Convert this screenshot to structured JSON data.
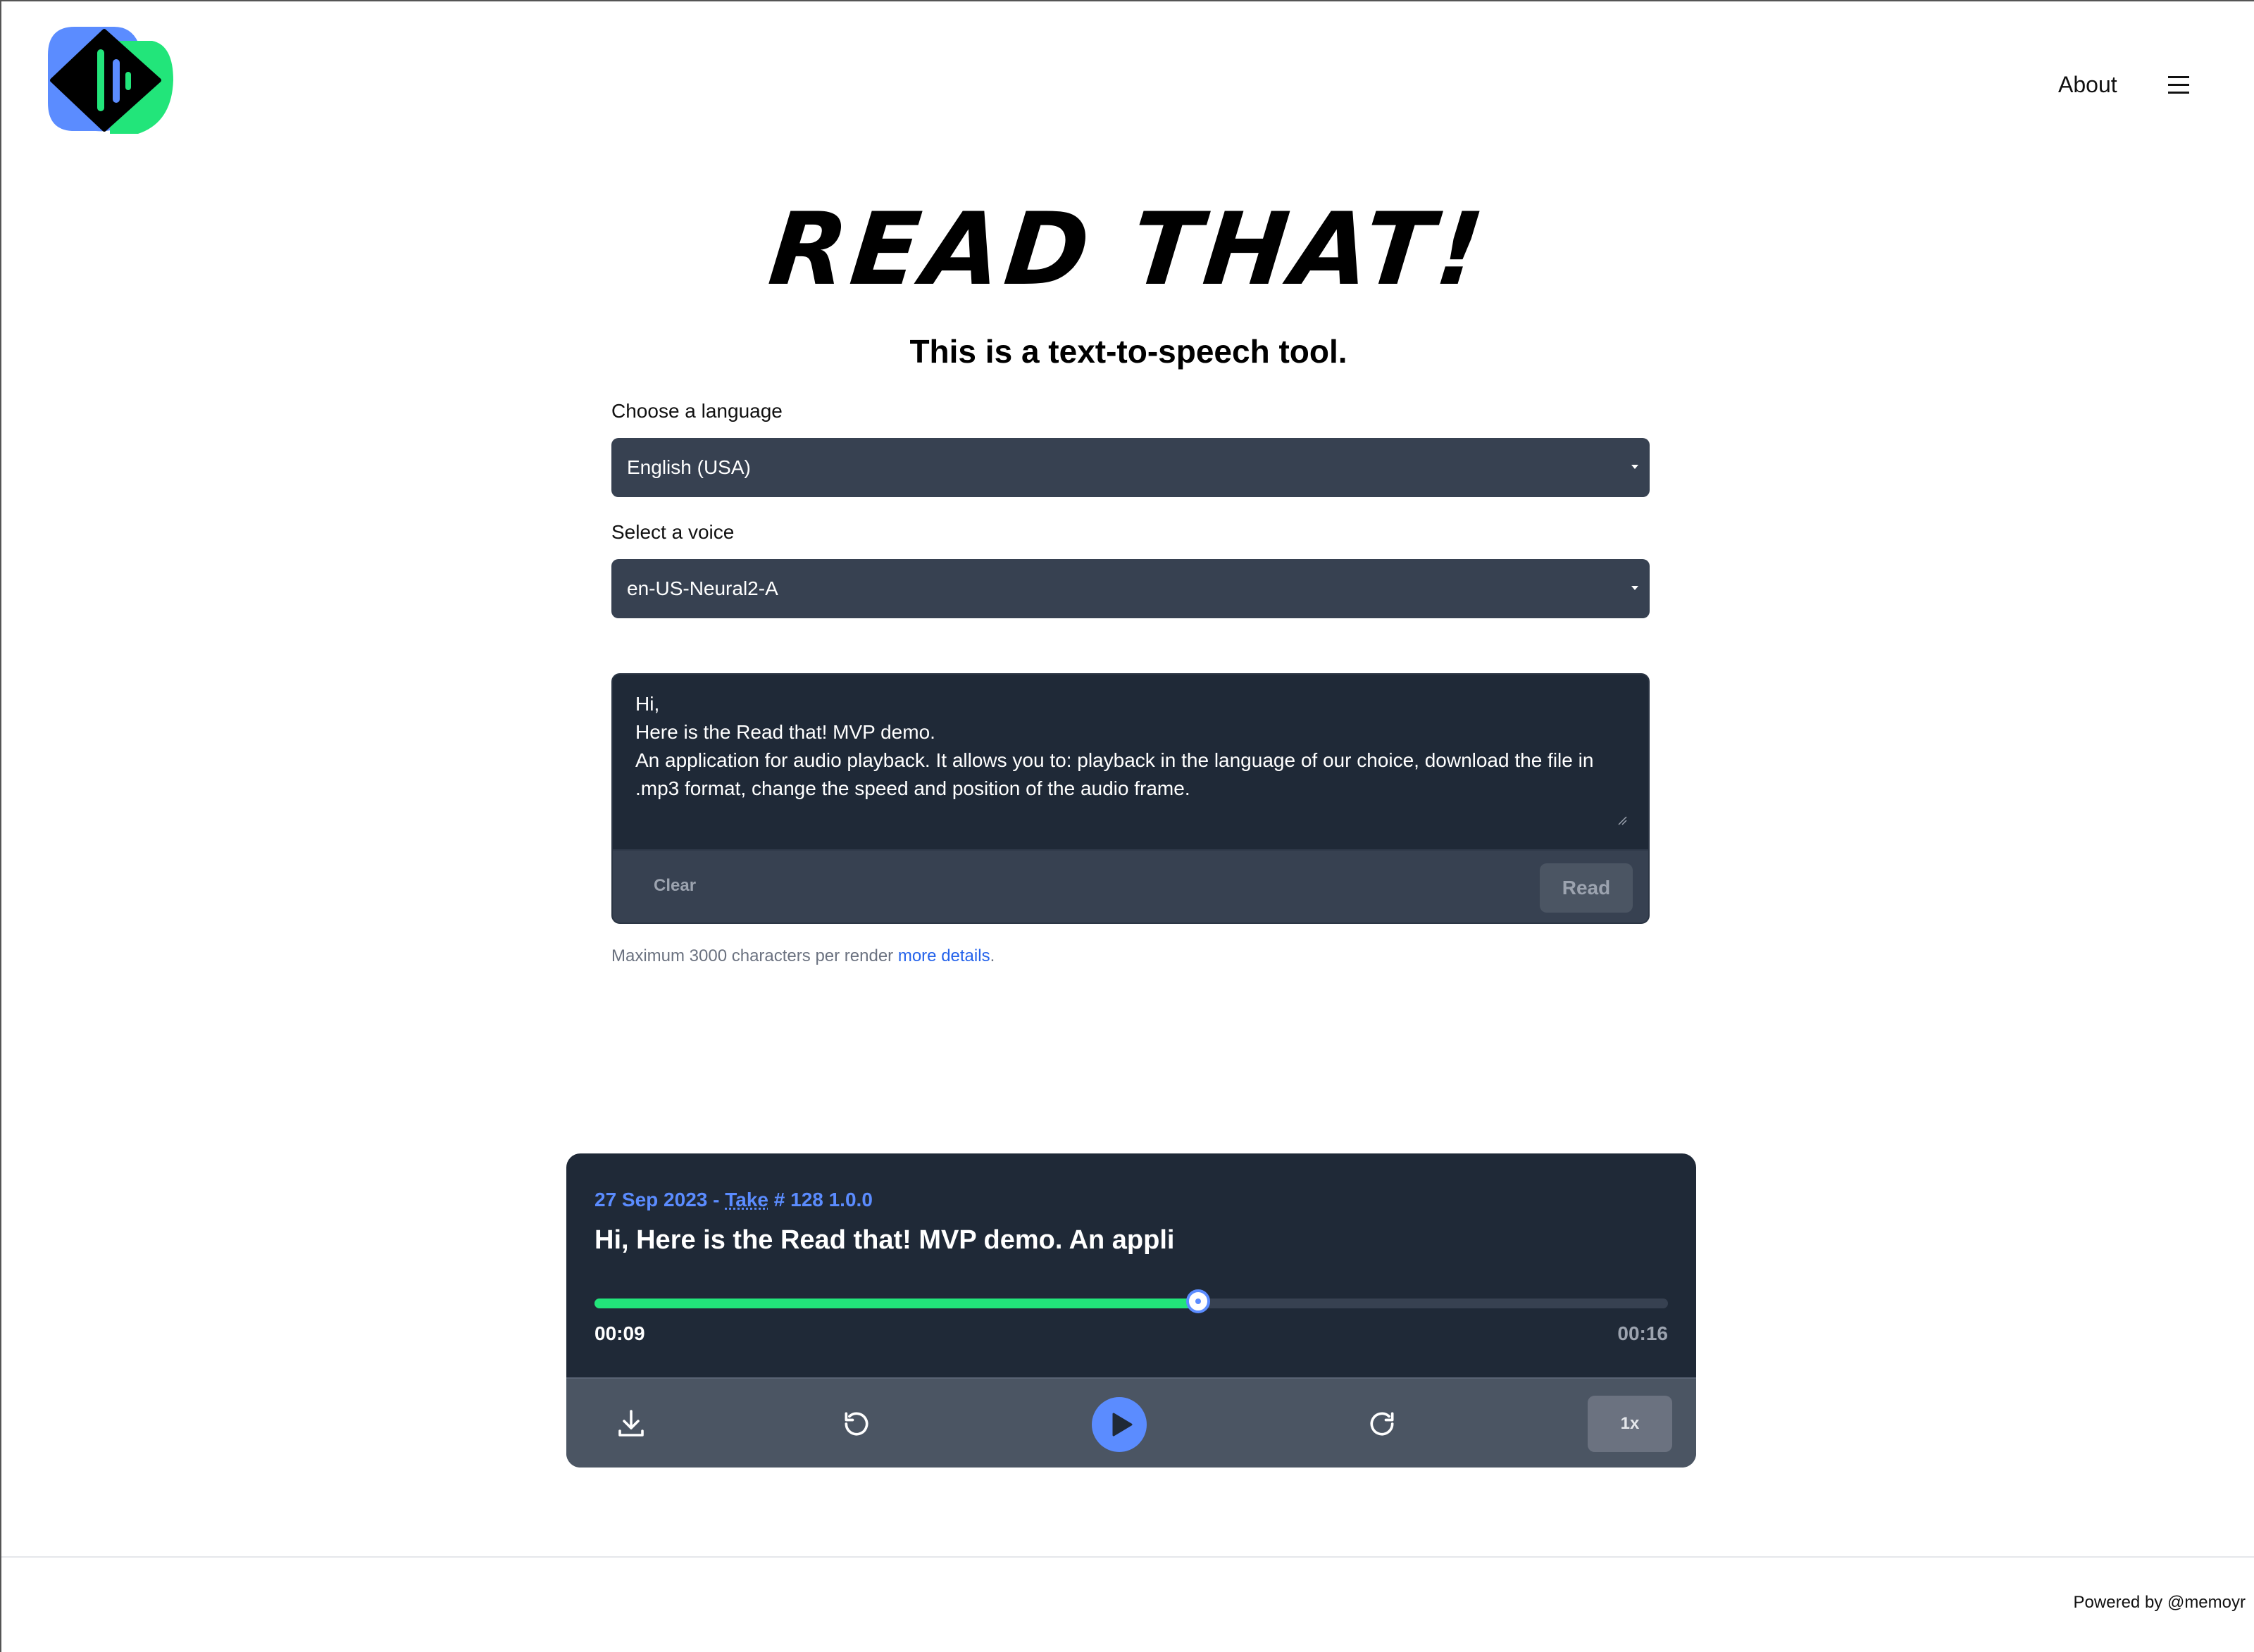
{
  "header": {
    "logo_icon": "read-that-logo",
    "nav_about": "About",
    "menu_icon": "hamburger-menu-icon"
  },
  "hero": {
    "title": "READ THAT!",
    "subtitle": "This is a text-to-speech tool."
  },
  "form": {
    "language_label": "Choose a language",
    "language_value": "English (USA)",
    "voice_label": "Select a voice",
    "voice_value": "en-US-Neural2-A",
    "text": "Hi,\nHere is the Read that! MVP demo.\nAn application for audio playback. It allows you to: playback in the language of our choice, download the file in .mp3 format, change the speed and position of the audio frame.",
    "clear_label": "Clear",
    "read_label": "Read",
    "hint_text": "Maximum 3000 characters per render ",
    "hint_link": "more details",
    "hint_suffix": "."
  },
  "player": {
    "date": "27 Sep 2023 - ",
    "take_label": "Take",
    "take_info": " # 128 1.0.0",
    "track_title": "Hi, Here is the Read that! MVP demo. An appli",
    "progress": 0.5625,
    "current_time": "00:09",
    "total_time": "00:16",
    "speed_label": "1x",
    "accent_color": "#5b8cff",
    "progress_color": "#22e57a"
  },
  "footer": {
    "powered_by": "Powered by @memoyr"
  }
}
